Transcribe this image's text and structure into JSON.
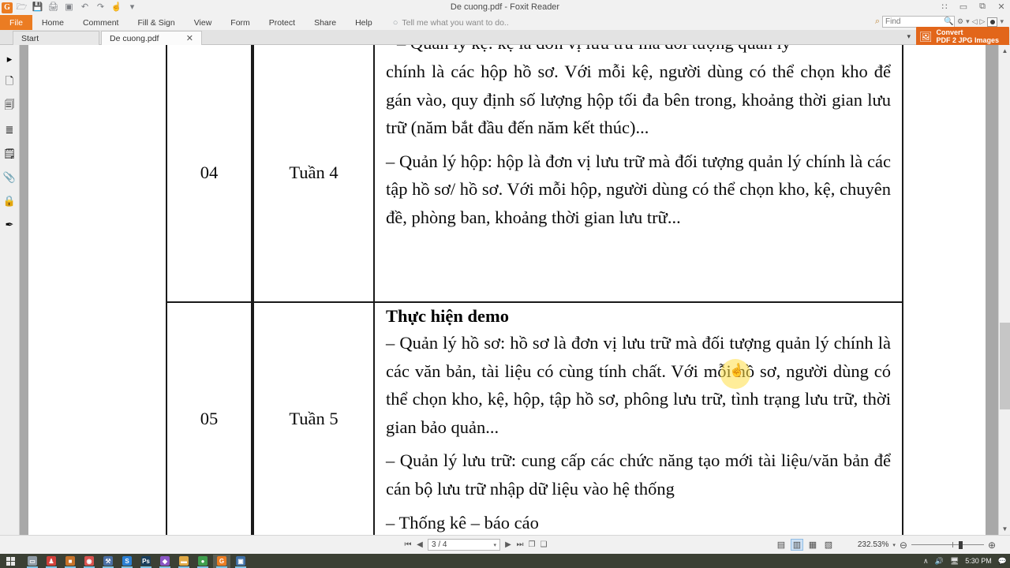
{
  "window": {
    "title": "De cuong.pdf - Foxit Reader",
    "minimize": "–",
    "maximize": "▭",
    "restore": "⧉",
    "close": "✕",
    "grid_icon": "∷"
  },
  "quick_access": {
    "logo": "G",
    "items": [
      {
        "name": "open-icon",
        "glyph": "🗁"
      },
      {
        "name": "save-icon",
        "glyph": "💾"
      },
      {
        "name": "print-icon",
        "glyph": "🖨"
      },
      {
        "name": "screenshot-icon",
        "glyph": "▣"
      },
      {
        "name": "undo-icon",
        "glyph": "↶"
      },
      {
        "name": "redo-icon",
        "glyph": "↷"
      },
      {
        "name": "hand-tool-icon",
        "glyph": "☝"
      },
      {
        "name": "customize-caret-icon",
        "glyph": "▾"
      }
    ]
  },
  "ribbon": {
    "file": "File",
    "tabs": [
      "Home",
      "Comment",
      "Fill & Sign",
      "View",
      "Form",
      "Protect",
      "Share",
      "Help"
    ],
    "tell_me": "Tell me what you want to do..",
    "bulb_icon": "○"
  },
  "search": {
    "placeholder": "Find",
    "value": "",
    "magnifier_icon": "🔍",
    "pre_icon": "⌕",
    "settings_icon": "⚙",
    "caret_icon": "▾",
    "prev_icon": "◁",
    "next_icon": "▷",
    "account_caret": "▾"
  },
  "doc_tabs": [
    {
      "label": "Start",
      "closable": false
    },
    {
      "label": "De cuong.pdf",
      "closable": true,
      "close_glyph": "✕"
    }
  ],
  "left_rail": [
    {
      "name": "pointer-icon",
      "glyph": "▸"
    },
    {
      "name": "bookmark-page-icon",
      "glyph": "🗋"
    },
    {
      "name": "pages-thumbnail-icon",
      "glyph": "🗐"
    },
    {
      "name": "layers-icon",
      "glyph": "≣"
    },
    {
      "name": "comments-icon",
      "glyph": "🗒"
    },
    {
      "name": "attachments-icon",
      "glyph": "📎"
    },
    {
      "name": "security-lock-icon",
      "glyph": "🔒"
    },
    {
      "name": "signature-icon",
      "glyph": "✒"
    }
  ],
  "convert_banner": {
    "line1": "Convert",
    "line2": "PDF 2 JPG Images",
    "icon": "🖼",
    "caret": "▾"
  },
  "document": {
    "rows": [
      {
        "no": "04",
        "week": "Tuần 4",
        "clipped_line": "– Quản lý kệ: kệ là đơn vị lưu trữ mà đối tượng quản lý",
        "paragraphs": [
          "chính là các hộp hồ sơ. Với mỗi kệ, người dùng có thể chọn kho để gán vào, quy định số lượng hộp tối đa bên trong, khoảng thời gian lưu trữ (năm bắt đầu đến năm kết thúc)...",
          "– Quản lý hộp: hộp là đơn vị lưu trữ mà đối tượng quản lý chính là các tập hồ sơ/ hồ sơ. Với mỗi hộp, người dùng có thể chọn kho, kệ, chuyên đề, phòng ban, khoảng thời gian lưu trữ..."
        ]
      },
      {
        "no": "05",
        "week": "Tuần 5",
        "heading": "Thực hiện demo",
        "paragraphs": [
          "– Quản lý hồ sơ: hồ sơ là đơn vị lưu trữ mà đối tượng quản lý chính là các văn bản, tài liệu có cùng tính chất. Với mỗi hồ sơ, người dùng có thể chọn kho, kệ, hộp, tập hồ sơ, phông lưu trữ, tình trạng lưu trữ, thời gian bảo quản...",
          "– Quản lý lưu trữ: cung cấp các chức năng tạo mới tài liệu/văn bản để cán bộ lưu trữ nhập dữ liệu vào hệ thống",
          "– Thống kê – báo cáo"
        ]
      }
    ],
    "cursor_icon": "☝"
  },
  "status_bar": {
    "first_page_icon": "⏮",
    "prev_page_icon": "◀",
    "page_value": "3 / 4",
    "page_caret": "▾",
    "next_page_icon": "▶",
    "last_page_icon": "⏭",
    "fit_page_icon": "❐",
    "fit_width_icon": "❑",
    "view_modes": [
      {
        "name": "single-page-view",
        "glyph": "▤",
        "selected": false
      },
      {
        "name": "continuous-scroll-view",
        "glyph": "▥",
        "selected": true
      },
      {
        "name": "facing-view",
        "glyph": "▦",
        "selected": false
      },
      {
        "name": "separate-cover-view",
        "glyph": "▧",
        "selected": false
      }
    ],
    "zoom_caret": "▾",
    "zoom_out_icon": "⊖",
    "zoom_value": "232.53%",
    "zoom_in_icon": "⊕"
  },
  "scrollbar": {
    "up_icon": "▲",
    "down_icon": "▼"
  },
  "taskbar": {
    "apps": [
      {
        "name": "task-view-icon",
        "label": "▭",
        "color": "#8f9ba5",
        "active": false
      },
      {
        "name": "app-red-icon",
        "label": "♟",
        "color": "#d1403a",
        "active": false
      },
      {
        "name": "app-store-icon",
        "label": "■",
        "color": "#c7732a",
        "active": false
      },
      {
        "name": "chrome-icon",
        "label": "◉",
        "color": "#d9534f",
        "active": false
      },
      {
        "name": "app-tools-icon",
        "label": "⚒",
        "color": "#4a6fa5",
        "active": false
      },
      {
        "name": "skype-icon",
        "label": "S",
        "color": "#2a7fd4",
        "active": false
      },
      {
        "name": "photoshop-icon",
        "label": "Ps",
        "color": "#1b3f5c",
        "active": false
      },
      {
        "name": "visual-studio-icon",
        "label": "◆",
        "color": "#8a56c4",
        "active": false
      },
      {
        "name": "file-explorer-icon",
        "label": "▬",
        "color": "#e0a945",
        "active": false
      },
      {
        "name": "app-green-icon",
        "label": "●",
        "color": "#3f9e4d",
        "active": false
      },
      {
        "name": "foxit-reader-icon",
        "label": "G",
        "color": "#eb7c22",
        "active": true
      },
      {
        "name": "app-blue-icon",
        "label": "▣",
        "color": "#3f6fa5",
        "active": false
      }
    ],
    "tray": {
      "chevron_icon": "∧",
      "volume_icon": "🔊",
      "network_icon": "🖥",
      "clock": "5:30 PM",
      "action_center_icon": "💬"
    }
  }
}
